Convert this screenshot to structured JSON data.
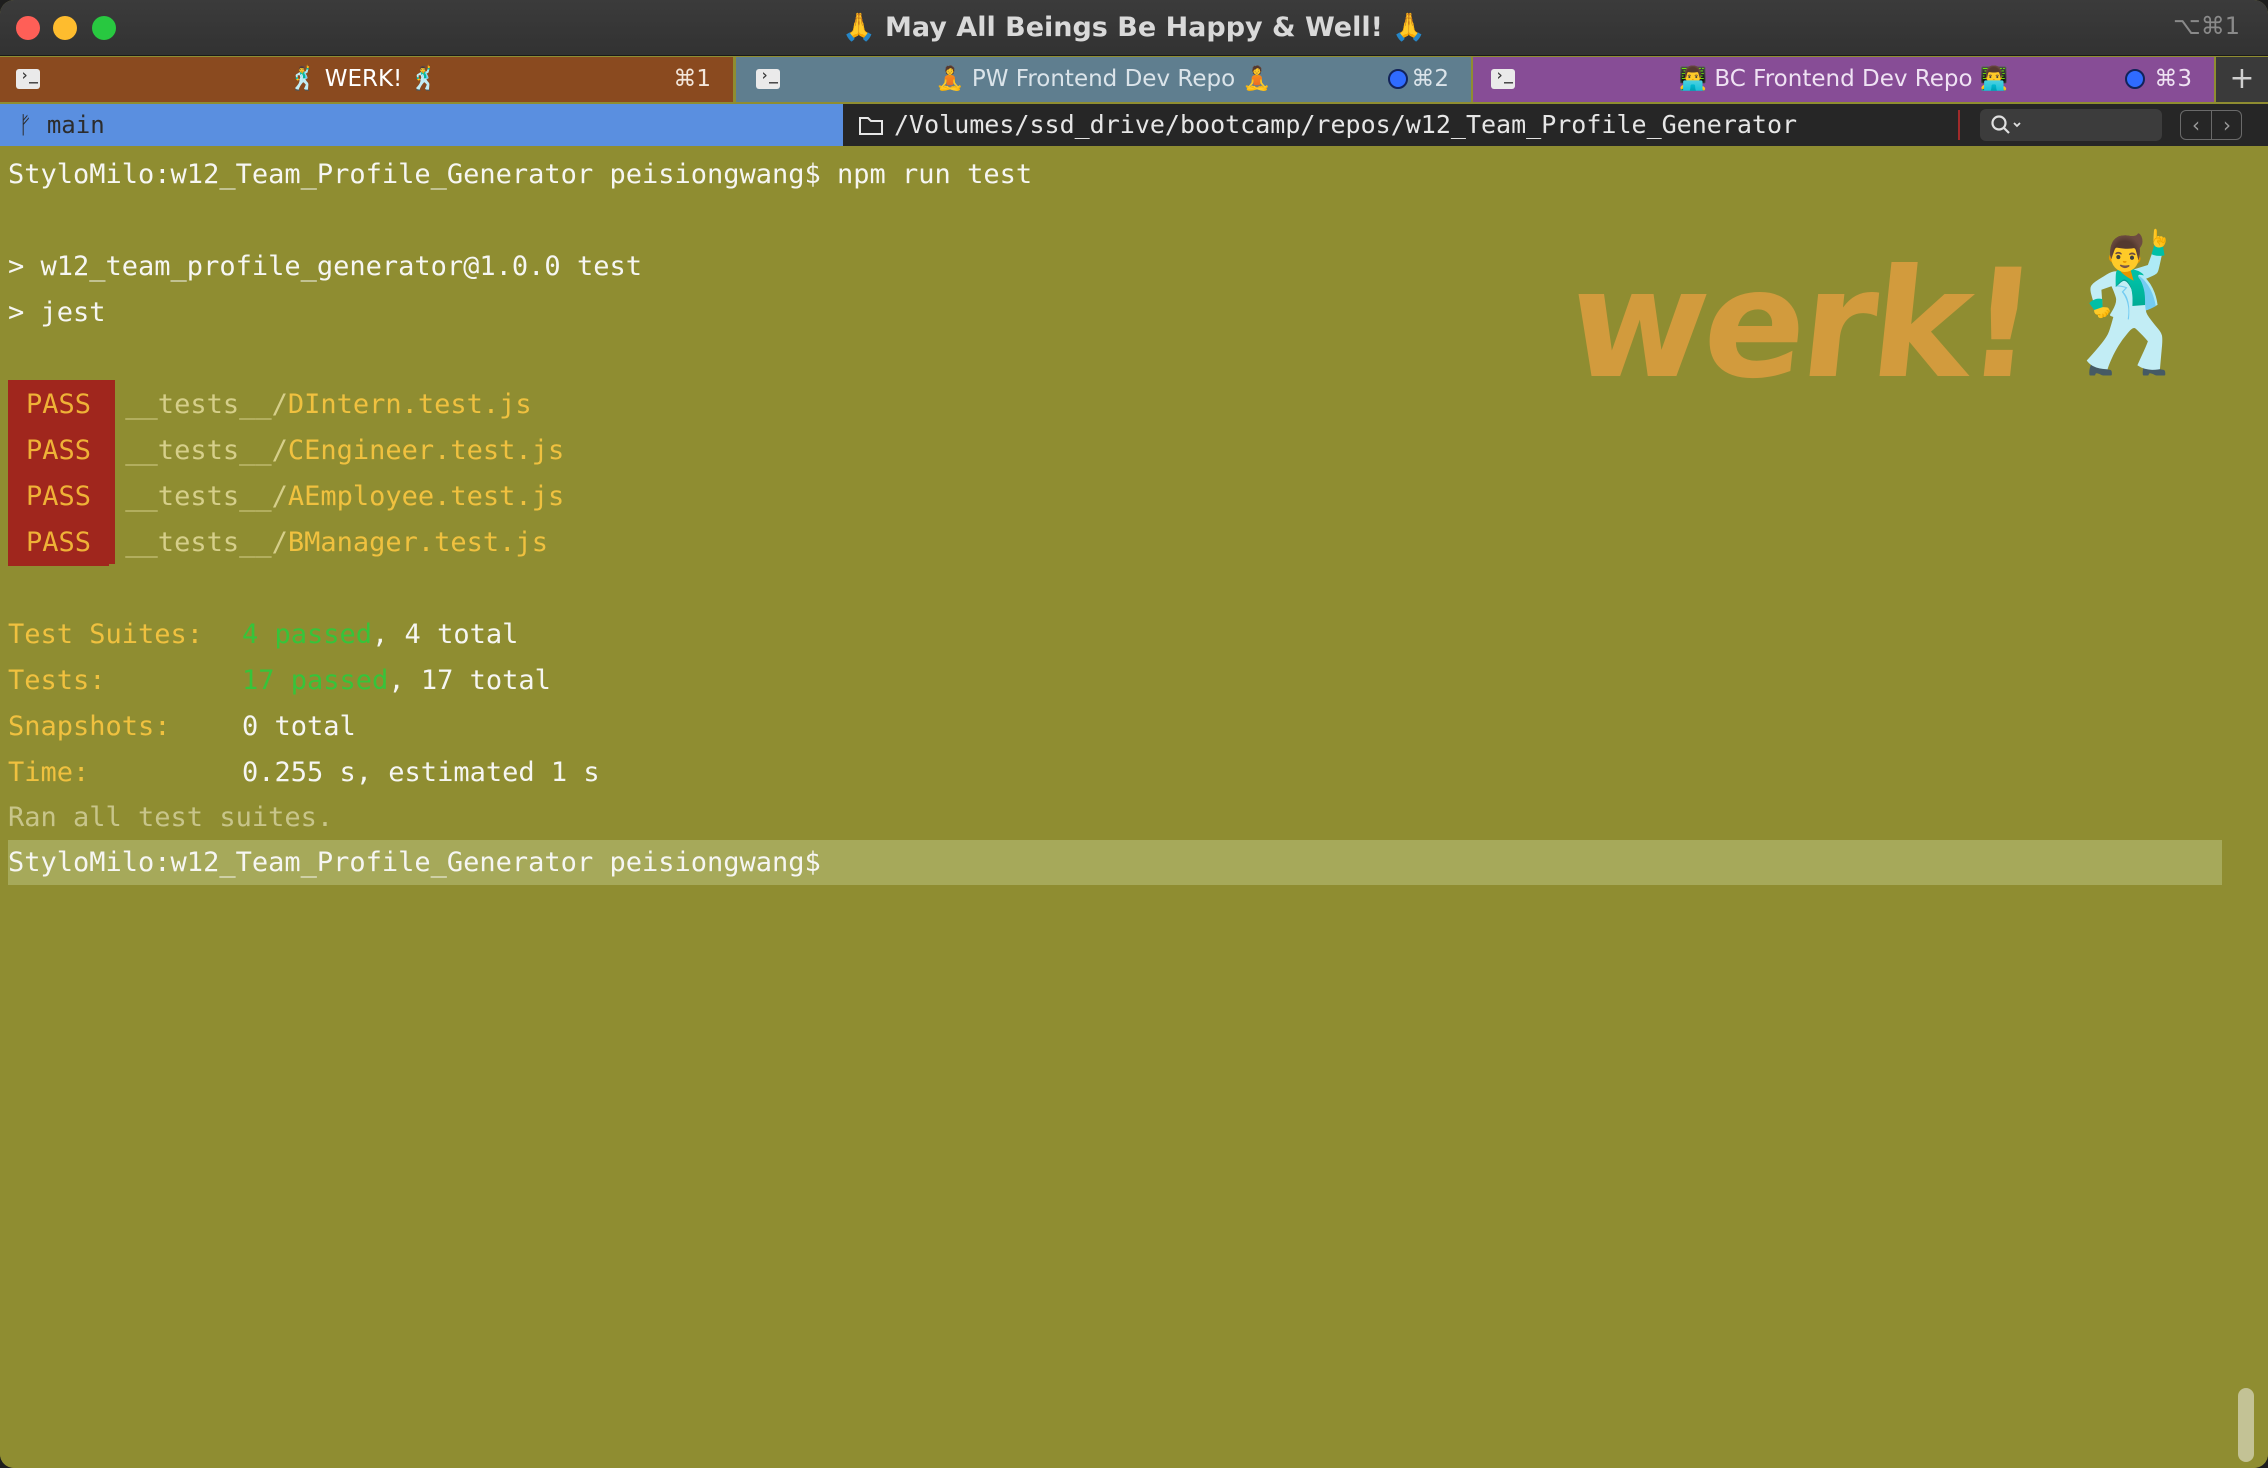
{
  "window": {
    "title": "🙏 May All Beings Be Happy & Well! 🙏",
    "title_shortcut": "⌥⌘1",
    "traffic_lights": {
      "close": "#ff5f57",
      "minimize": "#febc2e",
      "zoom": "#28c840"
    }
  },
  "tabs": [
    {
      "label": "🕺 WERK! 🕺",
      "shortcut": "⌘1",
      "color": "#8a4a1f",
      "active": true
    },
    {
      "label": "🧘 PW Frontend Dev Repo 🧘",
      "shortcut": "⌘2",
      "color": "#5f7e8f",
      "active": false
    },
    {
      "label": "👨‍💻 BC Frontend Dev Repo 👨‍💻",
      "shortcut": "⌘3",
      "color": "#874d96",
      "active": false
    }
  ],
  "new_tab_label": "+",
  "pathbar": {
    "branch": "ᚠ main",
    "path": "/Volumes/ssd_drive/bootcamp/repos/w12_Team_Profile_Generator",
    "search_placeholder": "",
    "nav_back": "‹",
    "nav_forward": "›"
  },
  "terminal": {
    "prompt1": "StyloMilo:w12_Team_Profile_Generator peisiongwang$ npm run test",
    "script_line1": "> w12_team_profile_generator@1.0.0 test",
    "script_line2": "> jest",
    "pass_label": "PASS",
    "tests": [
      {
        "dir": "__tests__/",
        "file": "DIntern.test.js"
      },
      {
        "dir": "__tests__/",
        "file": "CEngineer.test.js"
      },
      {
        "dir": "__tests__/",
        "file": "AEmployee.test.js"
      },
      {
        "dir": "__tests__/",
        "file": "BManager.test.js"
      }
    ],
    "summary": {
      "suites_label": "Test Suites:",
      "suites_passed": "4 passed",
      "suites_total": ", 4 total",
      "tests_label": "Tests:",
      "tests_passed": "17 passed",
      "tests_total": ", 17 total",
      "snapshots_label": "Snapshots:",
      "snapshots_value": "0 total",
      "time_label": "Time:",
      "time_value": "0.255 s, estimated 1 s"
    },
    "ran_all": "Ran all test suites.",
    "prompt2": "StyloMilo:w12_Team_Profile_Generator peisiongwang$"
  },
  "watermark": {
    "text": "werk!",
    "emoji": "🕺"
  },
  "colors": {
    "terminal_bg": "#8f8d31",
    "pass_badge_bg": "#a0261d",
    "pass_badge_fg": "#efb237",
    "passed_green": "#36c43a",
    "label_yellow": "#f0c13f",
    "branch_bar": "#5a8fe0"
  }
}
